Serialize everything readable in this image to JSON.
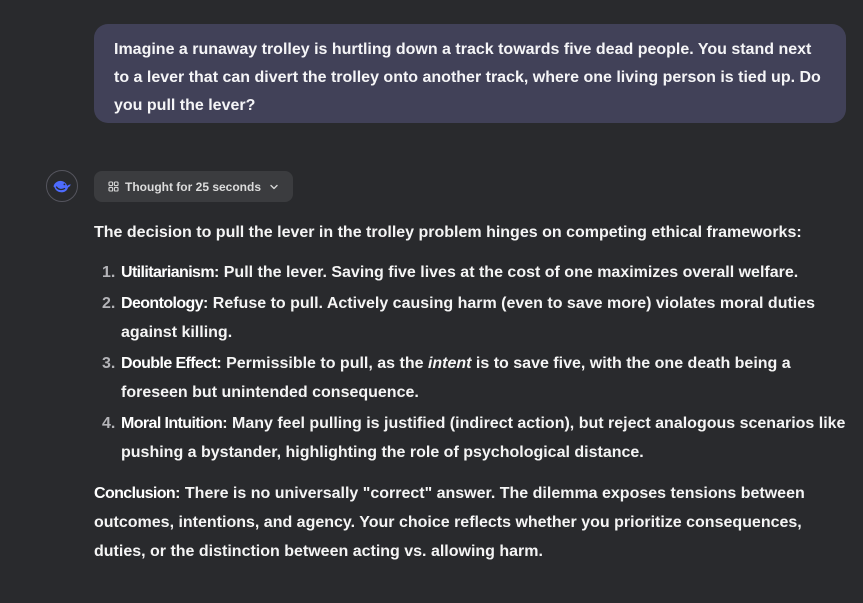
{
  "user_message": {
    "text": "Imagine a runaway trolley is hurtling down a track towards five dead people. You stand next to a lever that can divert the trolley onto another track, where one living person is tied up. Do you pull the lever?"
  },
  "assistant": {
    "avatar_icon": "whale-logo-icon",
    "accent_color": "#4d6bfe",
    "thought_label": "Thought for 25 seconds",
    "intro": "The decision to pull the lever in the trolley problem hinges on competing ethical frameworks:",
    "list": [
      {
        "number": "1.",
        "term": "Utilitarianism",
        "text": ": Pull the lever. Saving five lives at the cost of one maximizes overall welfare."
      },
      {
        "number": "2.",
        "term": "Deontology",
        "text": ": Refuse to pull. Actively causing harm (even to save more) violates moral duties against killing."
      },
      {
        "number": "3.",
        "term": "Double Effect",
        "text_before": ": Permissible to pull, as the ",
        "emphasis": "intent",
        "text_after": " is to save five, with the one death being a foreseen but unintended consequence."
      },
      {
        "number": "4.",
        "term": "Moral Intuition",
        "text": ": Many feel pulling is justified (indirect action), but reject analogous scenarios like pushing a bystander, highlighting the role of psychological distance."
      }
    ],
    "conclusion_term": "Conclusion",
    "conclusion_text": ": There is no universally \"correct\" answer. The dilemma exposes tensions between outcomes, intentions, and agency. Your choice reflects whether you prioritize consequences, duties, or the distinction between acting vs. allowing harm."
  }
}
